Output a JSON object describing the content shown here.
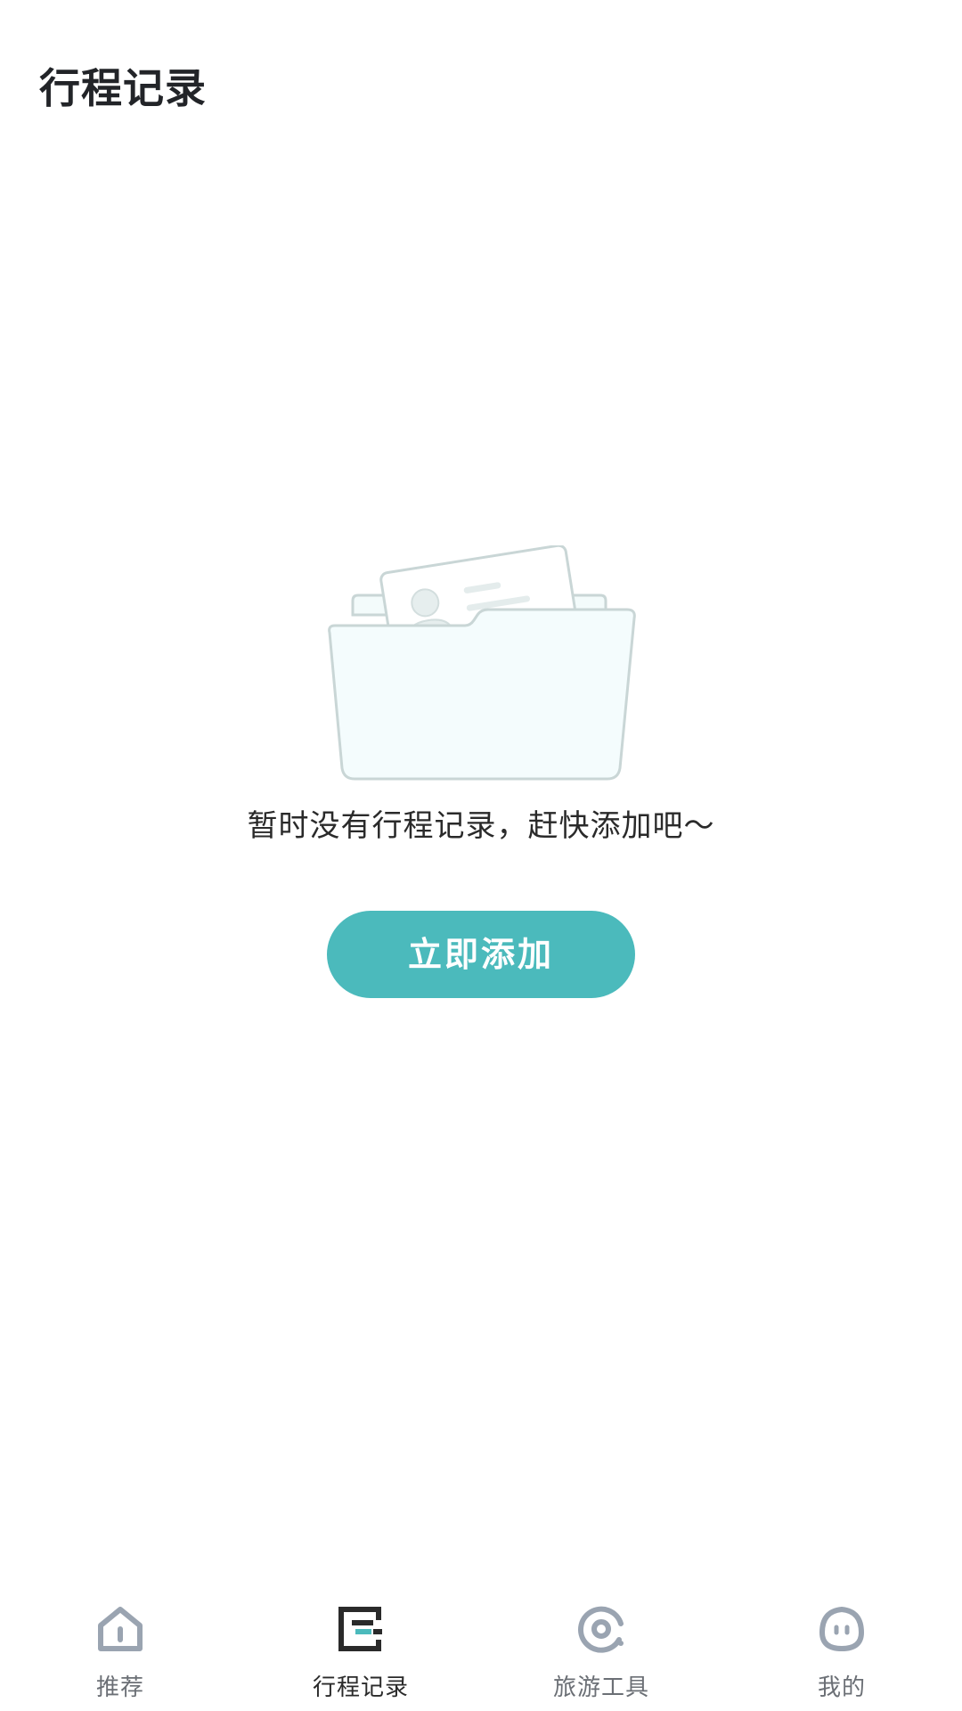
{
  "header": {
    "title": "行程记录"
  },
  "empty_state": {
    "illustration_icon": "folder-with-profile-card-icon",
    "message": "暂时没有行程记录，赶快添加吧～",
    "button_label": "立即添加"
  },
  "colors": {
    "accent": "#4bbabc",
    "nav_inactive": "#9aa4b1",
    "nav_active": "#2a2a2a"
  },
  "bottom_nav": {
    "active_index": 1,
    "items": [
      {
        "label": "推荐",
        "icon": "home-icon"
      },
      {
        "label": "行程记录",
        "icon": "itinerary-icon"
      },
      {
        "label": "旅游工具",
        "icon": "tools-eye-icon"
      },
      {
        "label": "我的",
        "icon": "profile-face-icon"
      }
    ]
  }
}
